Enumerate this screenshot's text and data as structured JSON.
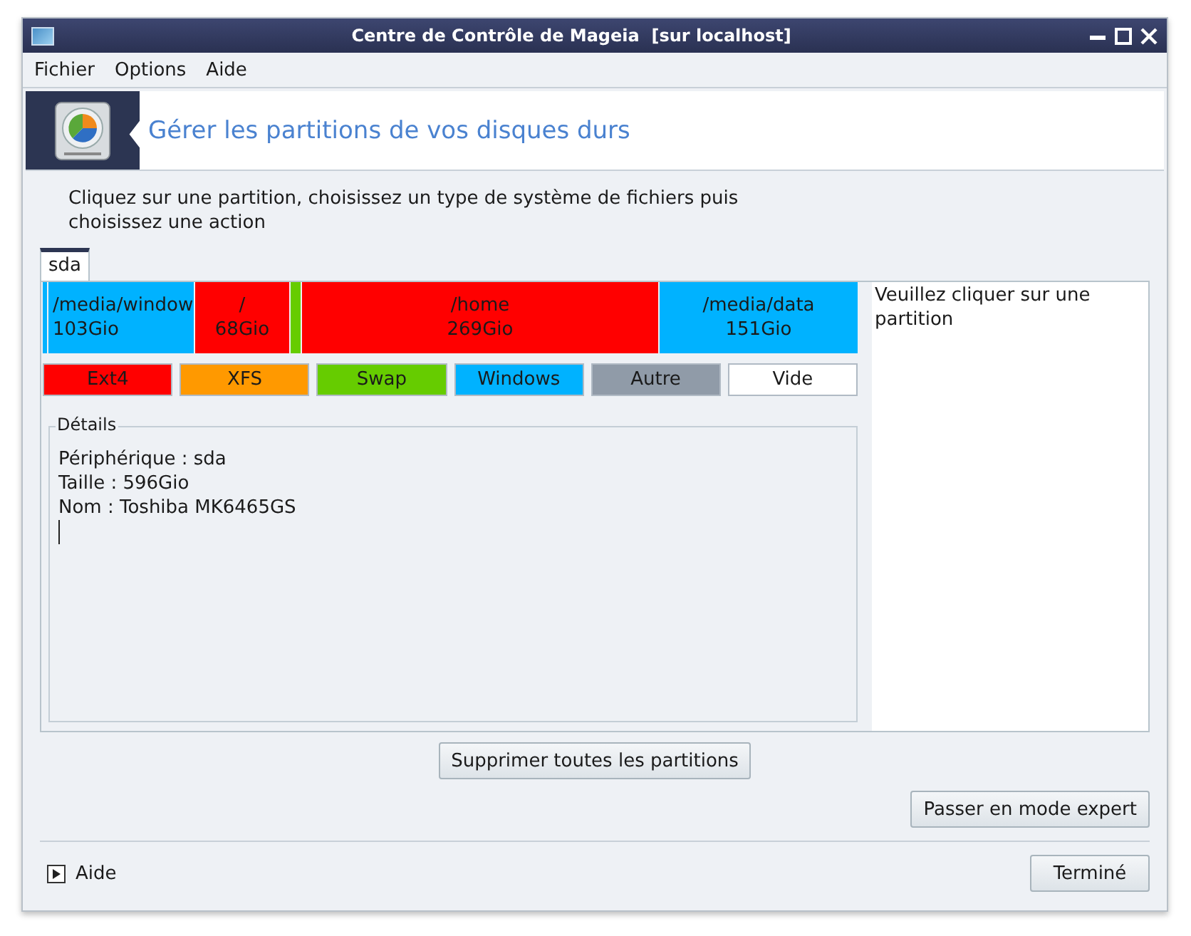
{
  "window": {
    "title": "Centre de Contrôle de Mageia  [sur localhost]"
  },
  "menu": [
    "Fichier",
    "Options",
    "Aide"
  ],
  "header": {
    "title": "Gérer les partitions de vos disques durs"
  },
  "instructions": "Cliquez sur une partition, choisissez un type de système de fichiers puis choisissez une action",
  "tabs": [
    {
      "label": "sda",
      "selected": true
    }
  ],
  "partitions": [
    {
      "color": "#00b2ff"
    },
    {
      "mount": "/media/window",
      "size": "103Gio",
      "color": "#00b2ff"
    },
    {
      "mount": "/",
      "size": "68Gio",
      "color": "#ff0000"
    },
    {
      "color": "#66cc00"
    },
    {
      "mount": "/home",
      "size": "269Gio",
      "color": "#ff0000"
    },
    {
      "mount": "/media/data",
      "size": "151Gio",
      "color": "#00b2ff"
    }
  ],
  "legend": [
    {
      "label": "Ext4",
      "color": "#ff0000"
    },
    {
      "label": "XFS",
      "color": "#ff9900"
    },
    {
      "label": "Swap",
      "color": "#66cc00"
    },
    {
      "label": "Windows",
      "color": "#00b2ff"
    },
    {
      "label": "Autre",
      "color": "#909ba8"
    },
    {
      "label": "Vide",
      "color": "#ffffff"
    }
  ],
  "details": {
    "title": "Détails",
    "lines": [
      "Périphérique : sda",
      "Taille : 596Gio",
      "Nom : Toshiba MK6465GS"
    ]
  },
  "hint": "Veuillez cliquer sur une partition",
  "buttons": {
    "clear": "Supprimer toutes les partitions",
    "expert": "Passer en mode expert",
    "help": "Aide",
    "done": "Terminé"
  }
}
